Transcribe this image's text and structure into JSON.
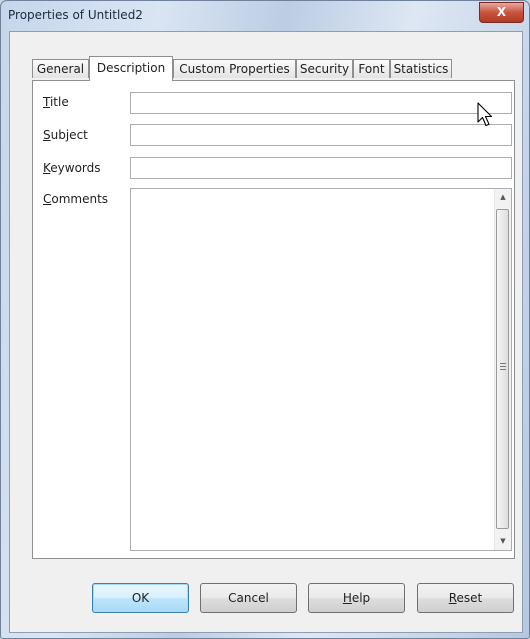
{
  "window": {
    "title": "Properties of Untitled2",
    "close_label": "X"
  },
  "tabs": [
    {
      "label": "General",
      "active": false
    },
    {
      "label": "Description",
      "active": true
    },
    {
      "label": "Custom Properties",
      "active": false
    },
    {
      "label": "Security",
      "active": false
    },
    {
      "label": "Font",
      "active": false
    },
    {
      "label": "Statistics",
      "active": false
    }
  ],
  "description": {
    "title": {
      "accel": "T",
      "rest": "itle",
      "value": ""
    },
    "subject": {
      "accel": "S",
      "rest": "ubject",
      "value": ""
    },
    "keywords": {
      "accel": "K",
      "rest": "eywords",
      "value": ""
    },
    "comments": {
      "accel": "C",
      "rest": "omments",
      "value": ""
    }
  },
  "buttons": {
    "ok": "OK",
    "cancel": "Cancel",
    "help": {
      "accel": "H",
      "rest": "elp"
    },
    "reset": {
      "accel": "R",
      "rest": "eset"
    }
  },
  "icons": {
    "scroll_up": "up-arrow-icon",
    "scroll_down": "down-arrow-icon",
    "mouse_cursor": "arrow-cursor-icon"
  },
  "colors": {
    "title_bar": "#cbd9ea",
    "close_button": "#c8533f",
    "default_button": "#bee6fd",
    "panel": "#ffffff",
    "dialog_bg": "#f0f0f0"
  }
}
